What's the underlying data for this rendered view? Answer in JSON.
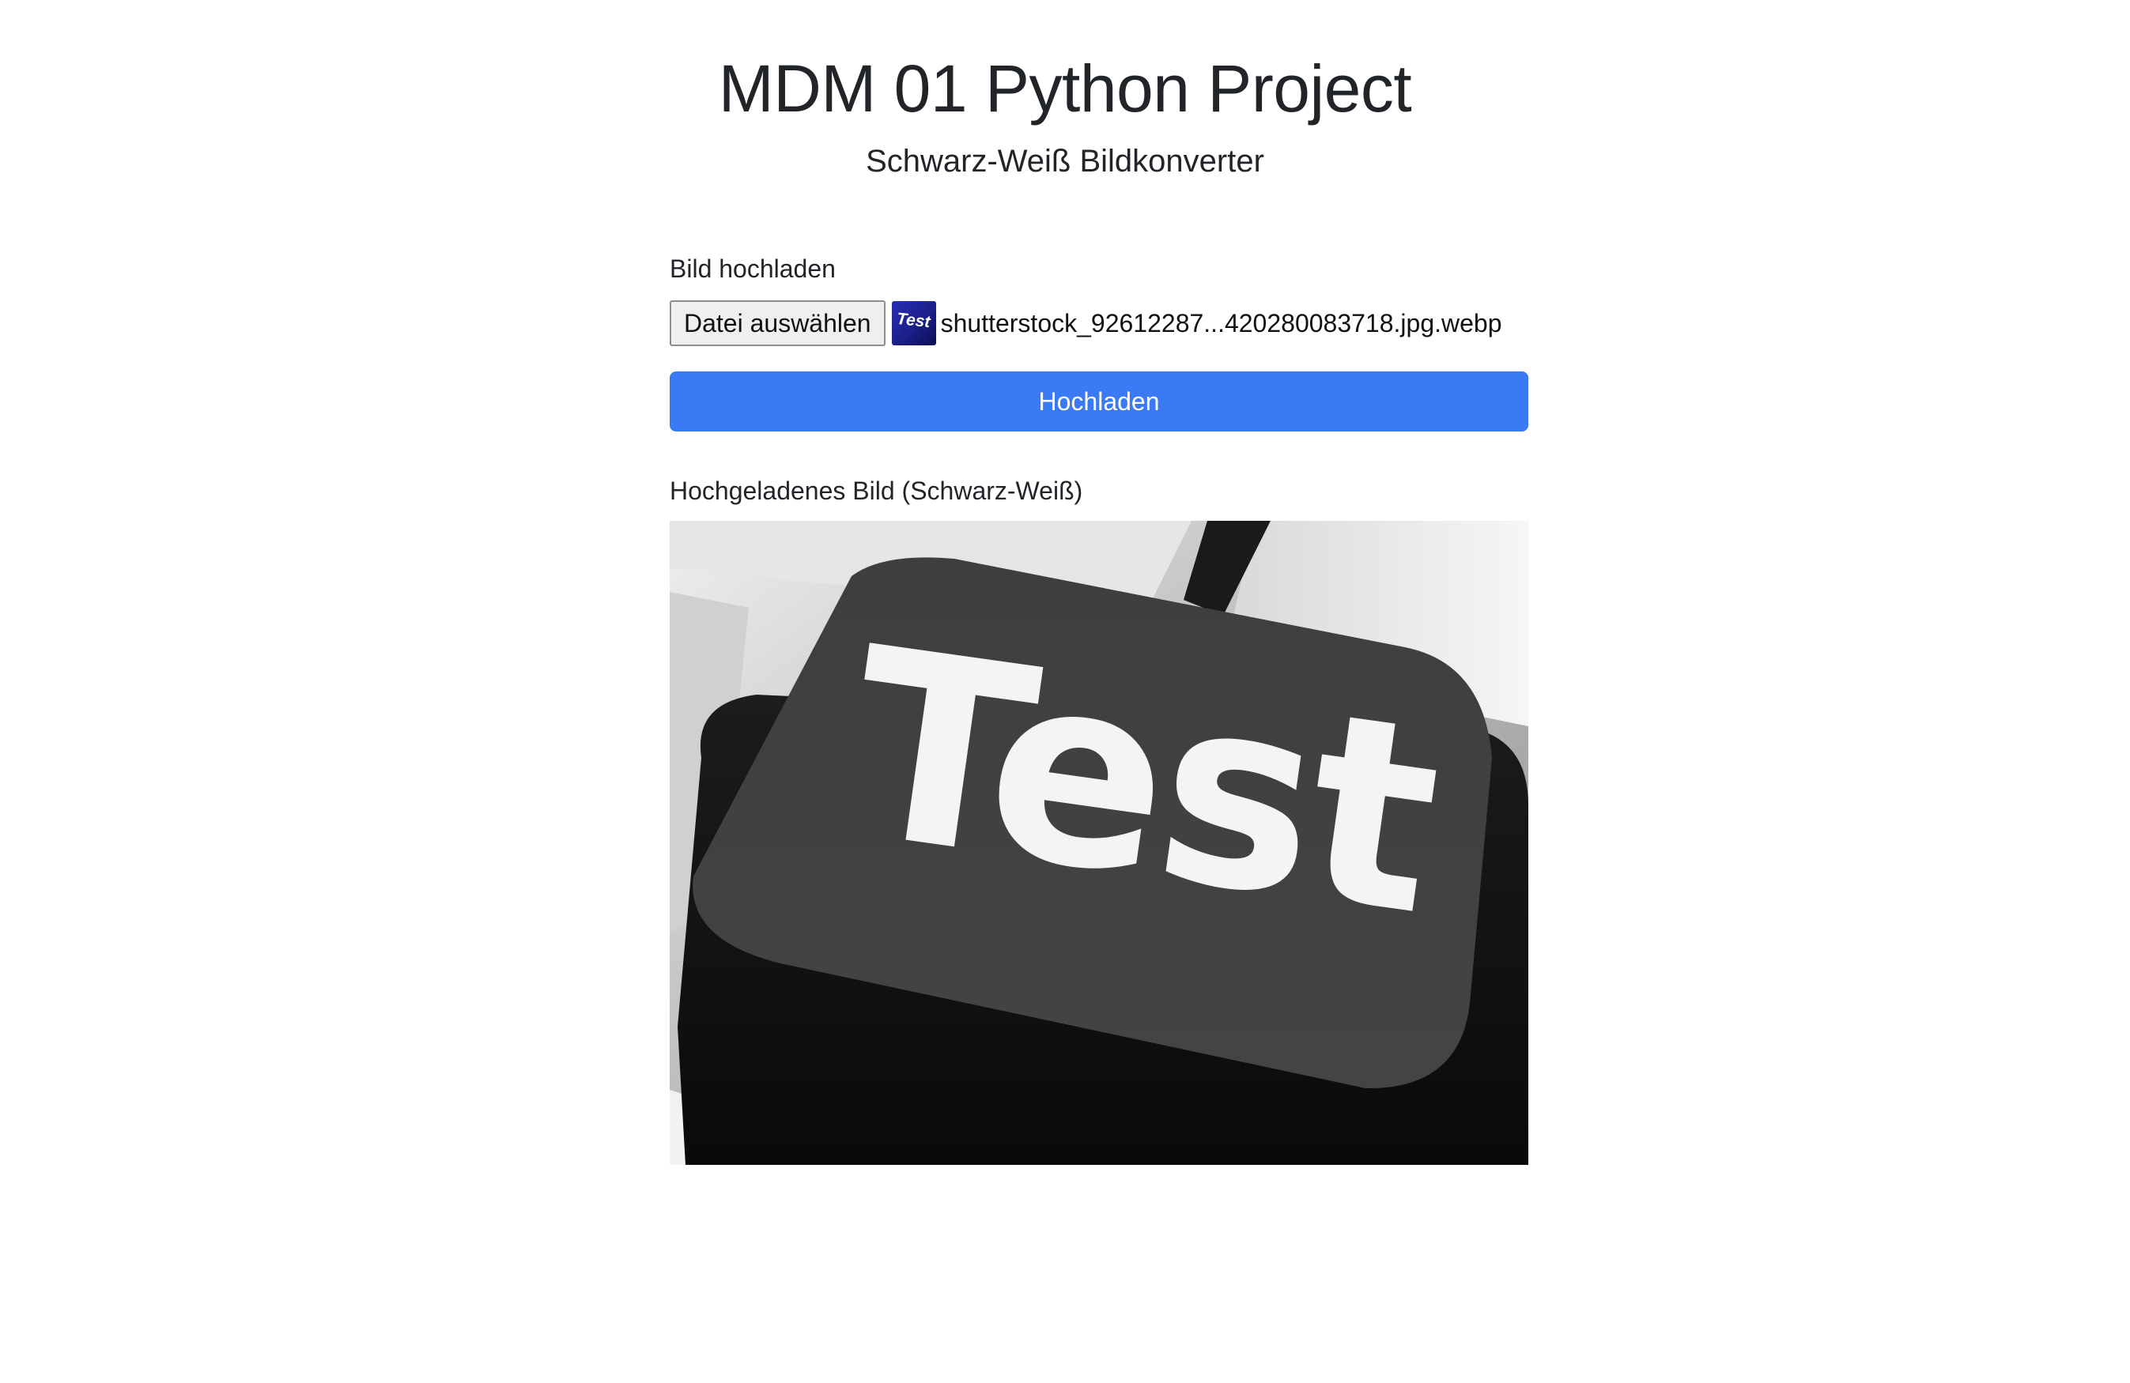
{
  "header": {
    "title": "MDM 01 Python Project",
    "subtitle": "Schwarz-Weiß Bildkonverter"
  },
  "upload_form": {
    "label": "Bild hochladen",
    "file_button_label": "Datei auswählen",
    "selected_file_name": "shutterstock_92612287...420280083718.jpg.webp",
    "thumbnail_text": "Test",
    "submit_label": "Hochladen"
  },
  "result": {
    "label": "Hochgeladenes Bild (Schwarz-Weiß)",
    "image_text": "Test"
  },
  "colors": {
    "primary": "#3a7bf5",
    "text": "#212529",
    "key_gray": "#404040"
  }
}
